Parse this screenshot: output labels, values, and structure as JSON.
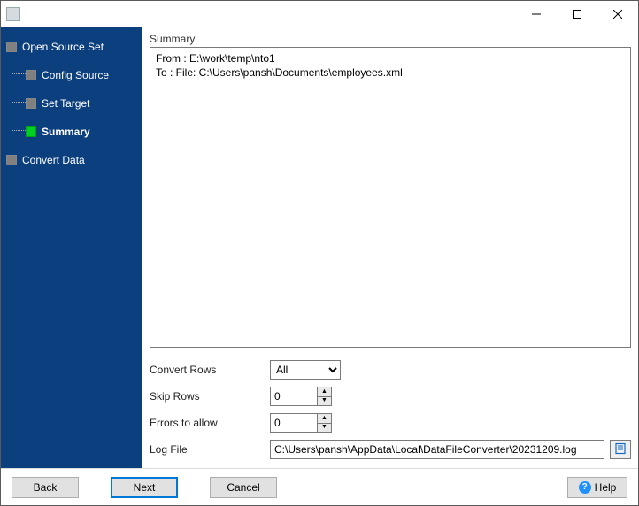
{
  "window": {
    "title": ""
  },
  "sidebar": {
    "items": [
      {
        "label": "Open Source Set",
        "level": 0,
        "active": false
      },
      {
        "label": "Config Source",
        "level": 1,
        "active": false
      },
      {
        "label": "Set Target",
        "level": 1,
        "active": false
      },
      {
        "label": "Summary",
        "level": 1,
        "active": true
      },
      {
        "label": "Convert Data",
        "level": 0,
        "active": false
      }
    ]
  },
  "main": {
    "section_label": "Summary",
    "summary_text": "From : E:\\work\\temp\\nto1\nTo : File: C:\\Users\\pansh\\Documents\\employees.xml",
    "fields": {
      "convert_rows_label": "Convert Rows",
      "convert_rows_value": "All",
      "convert_rows_options": [
        "All"
      ],
      "skip_rows_label": "Skip Rows",
      "skip_rows_value": "0",
      "errors_label": "Errors to allow",
      "errors_value": "0",
      "log_file_label": "Log File",
      "log_file_value": "C:\\Users\\pansh\\AppData\\Local\\DataFileConverter\\20231209.log"
    }
  },
  "footer": {
    "back": "Back",
    "next": "Next",
    "cancel": "Cancel",
    "help": "Help"
  }
}
